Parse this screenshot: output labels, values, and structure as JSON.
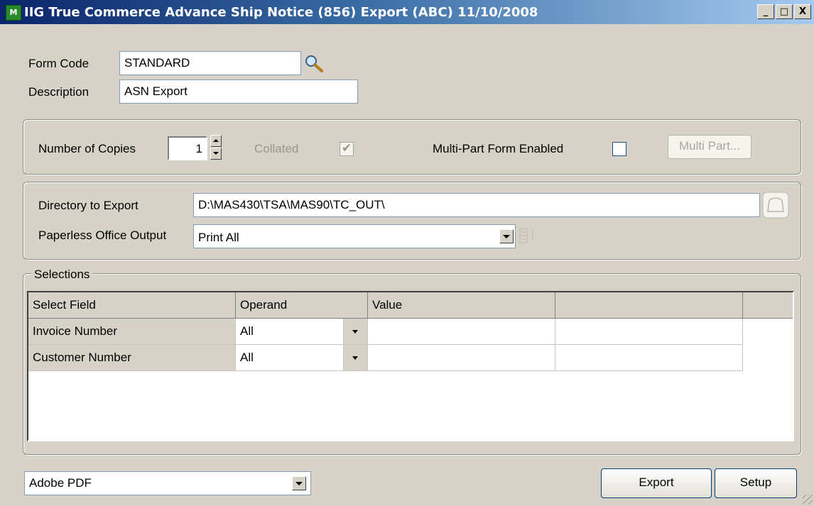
{
  "window": {
    "title": "IIG True Commerce Advance Ship Notice (856) Export (ABC) 11/10/2008",
    "app_icon": "MAS90-app-icon",
    "buttons": {
      "minimize": "_",
      "maximize": "□",
      "close": "X"
    }
  },
  "form": {
    "form_code_label": "Form Code",
    "form_code_value": "STANDARD",
    "description_label": "Description",
    "description_value": "ASN Export"
  },
  "copies": {
    "label": "Number of Copies",
    "value": "1",
    "collated_label": "Collated",
    "collated_checked": true,
    "multipart_label": "Multi-Part Form Enabled",
    "multipart_checked": false,
    "multipart_button": "Multi Part..."
  },
  "export": {
    "directory_label": "Directory to Export",
    "directory_value": "D:\\MAS430\\TSA\\MAS90\\TC_OUT\\",
    "paperless_label": "Paperless Office Output",
    "paperless_value": "Print All"
  },
  "selections": {
    "group_label": "Selections",
    "columns": [
      "Select Field",
      "Operand",
      "Value",
      ""
    ],
    "rows": [
      {
        "field": "Invoice Number",
        "operand": "All",
        "value": "",
        "extra": ""
      },
      {
        "field": "Customer Number",
        "operand": "All",
        "value": "",
        "extra": ""
      }
    ]
  },
  "footer": {
    "printer_value": "Adobe PDF",
    "export_button": "Export",
    "setup_button": "Setup"
  },
  "colors": {
    "title_gradient_start": "#0a246a",
    "title_gradient_end": "#a6caf0",
    "window_bg": "#d6d2c8"
  }
}
